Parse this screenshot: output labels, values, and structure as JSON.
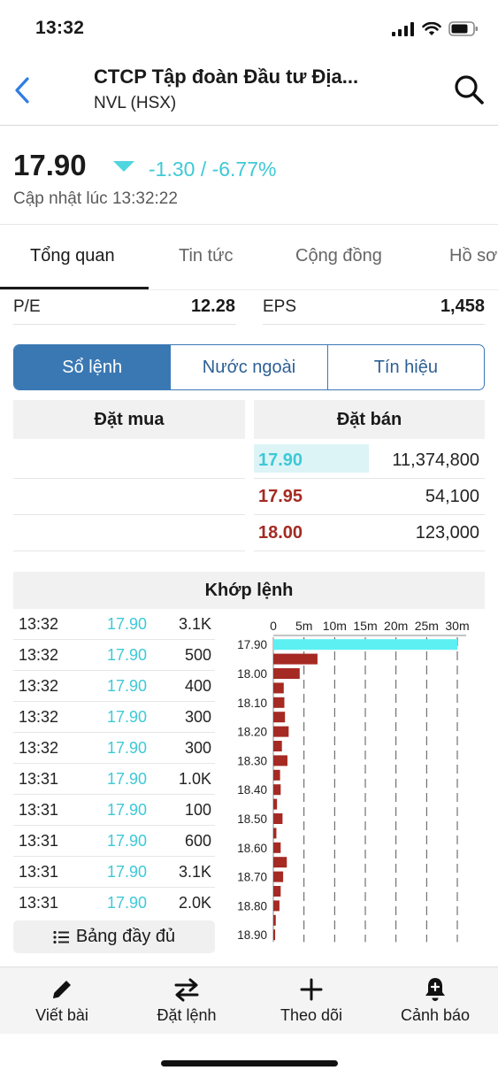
{
  "status_bar": {
    "time": "13:32",
    "icons": [
      "signal-icon",
      "wifi-icon",
      "battery-icon"
    ]
  },
  "header": {
    "title": "CTCP Tập đoàn Đầu tư Địa...",
    "subtitle": "NVL (HSX)",
    "icons": [
      "back-chevron-icon",
      "search-icon"
    ]
  },
  "price": {
    "value": "17.90",
    "change": "-1.30 / -6.77%",
    "updated": "Cập nhật lúc 13:32:22",
    "direction": "down",
    "accent_color": "#3ec9d6"
  },
  "tabs": [
    {
      "label": "Tổng quan",
      "active": true
    },
    {
      "label": "Tin tức",
      "active": false
    },
    {
      "label": "Cộng đồng",
      "active": false
    },
    {
      "label": "Hồ sơ",
      "active": false
    }
  ],
  "metrics": [
    {
      "label": "P/E",
      "value": "12.28"
    },
    {
      "label": "EPS",
      "value": "1,458"
    }
  ],
  "segment": [
    {
      "label": "Sổ lệnh",
      "active": true
    },
    {
      "label": "Nước ngoài",
      "active": false
    },
    {
      "label": "Tín hiệu",
      "active": false
    }
  ],
  "orderbook": {
    "buy_header": "Đặt mua",
    "sell_header": "Đặt bán",
    "buy_rows": [],
    "sell_rows": [
      {
        "price": "17.90",
        "volume": "11,374,800",
        "color": "#3ec9d6",
        "highlight": true
      },
      {
        "price": "17.95",
        "volume": "54,100",
        "color": "#a42a23",
        "highlight": false
      },
      {
        "price": "18.00",
        "volume": "123,000",
        "color": "#a42a23",
        "highlight": false
      }
    ]
  },
  "matched": {
    "header": "Khớp lệnh",
    "rows": [
      {
        "time": "13:32",
        "price": "17.90",
        "volume": "3.1K"
      },
      {
        "time": "13:32",
        "price": "17.90",
        "volume": "500"
      },
      {
        "time": "13:32",
        "price": "17.90",
        "volume": "400"
      },
      {
        "time": "13:32",
        "price": "17.90",
        "volume": "300"
      },
      {
        "time": "13:32",
        "price": "17.90",
        "volume": "300"
      },
      {
        "time": "13:31",
        "price": "17.90",
        "volume": "1.0K"
      },
      {
        "time": "13:31",
        "price": "17.90",
        "volume": "100"
      },
      {
        "time": "13:31",
        "price": "17.90",
        "volume": "600"
      },
      {
        "time": "13:31",
        "price": "17.90",
        "volume": "3.1K"
      },
      {
        "time": "13:31",
        "price": "17.90",
        "volume": "2.0K"
      }
    ],
    "full_table_label": "Bảng đầy đủ"
  },
  "chart_data": {
    "type": "bar",
    "orientation": "horizontal",
    "x_ticks": [
      "0",
      "5m",
      "10m",
      "15m",
      "20m",
      "25m",
      "30m"
    ],
    "xlim": [
      0,
      30
    ],
    "x_unit": "m",
    "y_tick_labels": [
      "17.90",
      "18.00",
      "18.10",
      "18.20",
      "18.30",
      "18.40",
      "18.50",
      "18.60",
      "18.70",
      "18.80",
      "18.90"
    ],
    "grid": "vertical dashed",
    "categories": [
      "17.90",
      "17.95",
      "18.00",
      "18.05",
      "18.10",
      "18.15",
      "18.20",
      "18.25",
      "18.30",
      "18.35",
      "18.40",
      "18.45",
      "18.50",
      "18.55",
      "18.60",
      "18.65",
      "18.70",
      "18.75",
      "18.80",
      "18.85",
      "18.90"
    ],
    "values": [
      30.0,
      7.2,
      4.3,
      1.7,
      1.8,
      1.9,
      2.5,
      1.4,
      2.3,
      1.1,
      1.2,
      0.6,
      1.5,
      0.5,
      1.2,
      2.2,
      1.6,
      1.2,
      1.0,
      0.4,
      0.3
    ],
    "colors": {
      "current": "#5cf0f3",
      "ask": "#a42a23",
      "grid": "#555555"
    }
  },
  "bottom_nav": [
    {
      "label": "Viết bài",
      "icon": "pencil-icon"
    },
    {
      "label": "Đặt lệnh",
      "icon": "swap-arrows-icon"
    },
    {
      "label": "Theo dõi",
      "icon": "plus-icon"
    },
    {
      "label": "Cảnh báo",
      "icon": "bell-plus-icon"
    }
  ]
}
